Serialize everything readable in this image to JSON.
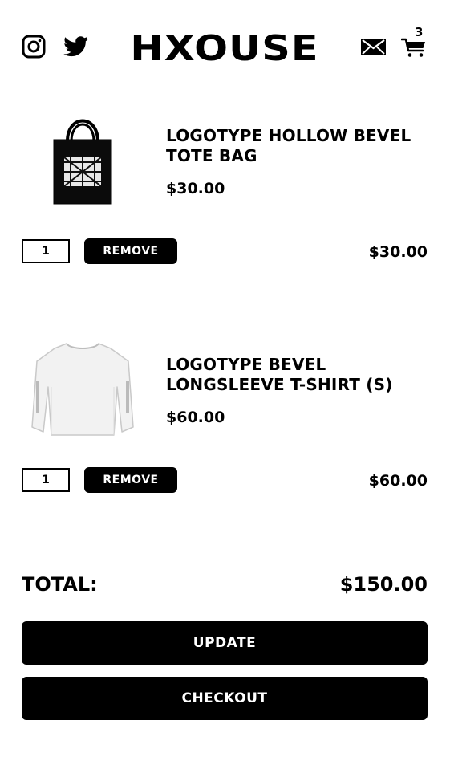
{
  "header": {
    "brand": "HXOUSE",
    "cart_count": "3",
    "icons": [
      "instagram-icon",
      "twitter-icon",
      "mail-icon",
      "cart-icon"
    ]
  },
  "cart": {
    "items": [
      {
        "title": "LOGOTYPE HOLLOW BEVEL TOTE BAG",
        "price": "$30.00",
        "quantity": "1",
        "remove_label": "REMOVE",
        "line_total": "$30.00"
      },
      {
        "title": "LOGOTYPE BEVEL LONGSLEEVE T-SHIRT (S)",
        "price": "$60.00",
        "quantity": "1",
        "remove_label": "REMOVE",
        "line_total": "$60.00"
      }
    ],
    "total_label": "TOTAL:",
    "total_value": "$150.00",
    "update_label": "UPDATE",
    "checkout_label": "CHECKOUT"
  }
}
